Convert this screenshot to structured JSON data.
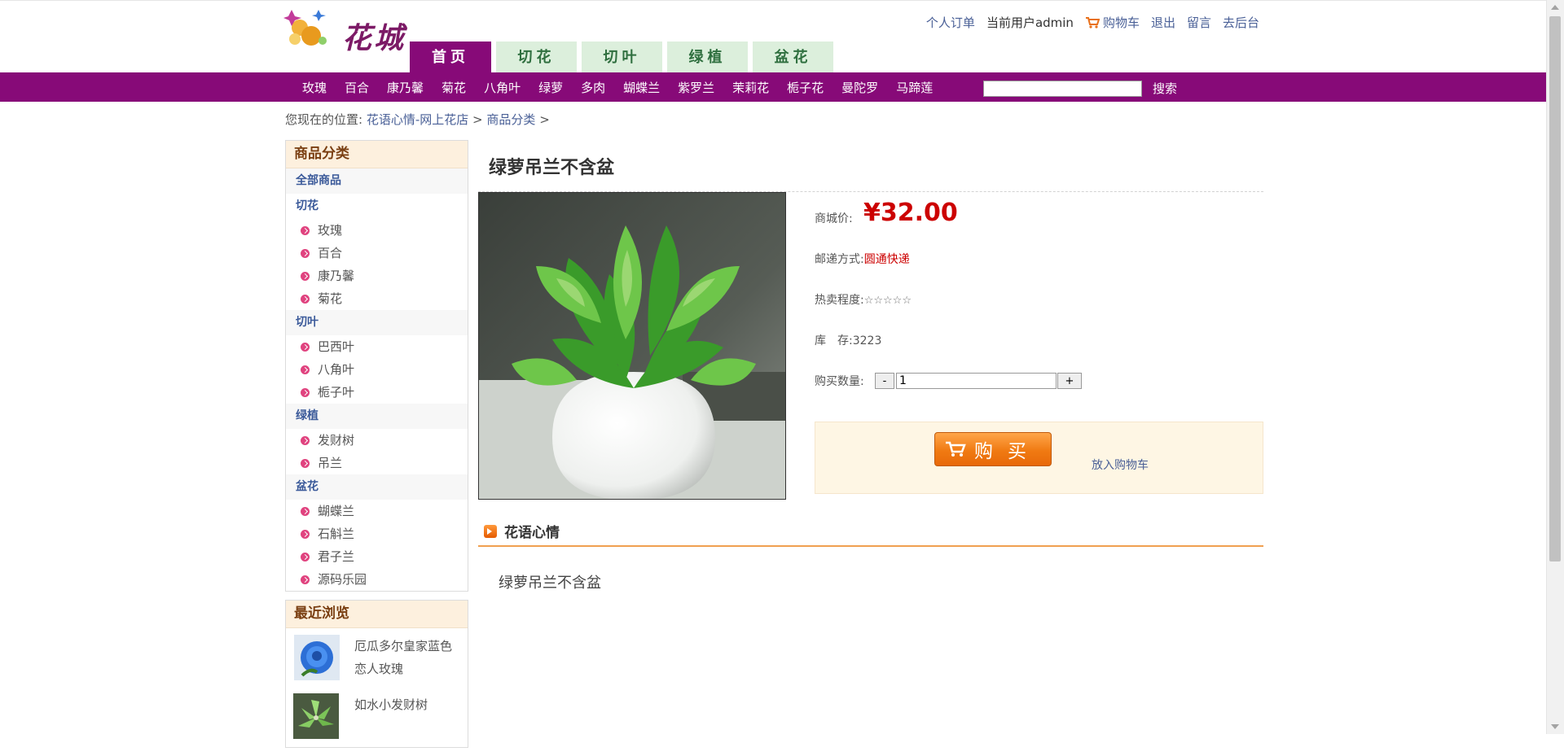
{
  "header": {
    "logo_text": "花城",
    "links": {
      "orders": "个人订单",
      "current_user": "当前用户admin",
      "cart": "购物车",
      "logout": "退出",
      "message": "留言",
      "backend": "去后台"
    },
    "tabs": [
      "首页",
      "切花",
      "切叶",
      "绿植",
      "盆花"
    ],
    "nav_items": [
      "玫瑰",
      "百合",
      "康乃馨",
      "菊花",
      "八角叶",
      "绿萝",
      "多肉",
      "蝴蝶兰",
      "紫罗兰",
      "茉莉花",
      "栀子花",
      "曼陀罗",
      "马蹄莲"
    ],
    "search_placeholder": "",
    "search_button": "搜索"
  },
  "breadcrumb": {
    "prefix": "您现在的位置:",
    "home": "花语心情-网上花店",
    "sep1": ">",
    "category": "商品分类",
    "sep2": ">"
  },
  "sidebar": {
    "category_title": "商品分类",
    "all_goods": "全部商品",
    "groups": {
      "cut_flowers": {
        "name": "切花",
        "items": [
          "玫瑰",
          "百合",
          "康乃馨",
          "菊花"
        ]
      },
      "cut_leaves": {
        "name": "切叶",
        "items": [
          "巴西叶",
          "八角叶",
          "栀子叶"
        ]
      },
      "green_plants": {
        "name": "绿植",
        "items": [
          "发财树",
          "吊兰"
        ]
      },
      "potted": {
        "name": "盆花",
        "items": [
          "蝴蝶兰",
          "石斛兰",
          "君子兰",
          "源码乐园"
        ]
      }
    },
    "recent_title": "最近浏览",
    "recent": [
      "厄瓜多尔皇家蓝色恋人玫瑰",
      "如水小发财树"
    ]
  },
  "product": {
    "title": "绿萝吊兰不含盆",
    "price_label": "商城价:",
    "price": "¥32.00",
    "shipping_label": "邮递方式:",
    "shipping_value": "圆通快递",
    "hot_label": "热卖程度:",
    "hot_stars": "☆☆☆☆☆",
    "stock_label": "库　存:",
    "stock_value": "3223",
    "qty_label": "购买数量:",
    "qty_minus": "-",
    "qty_value": "1",
    "qty_plus": "+",
    "buy_label": "购买",
    "add_cart": "放入购物车",
    "desc_title": "花语心情",
    "desc_text": "绿萝吊兰不含盆"
  },
  "colors": {
    "brand_purple": "#870a78",
    "price_red": "#cc0000",
    "tab_green_bg": "#dcefdc",
    "link_blue": "#4a6097",
    "accent_orange": "#f07a12"
  },
  "icons": [
    "logo-image",
    "cart-icon",
    "bullet-arrow-icon",
    "buy-cart-icon",
    "section-arrow-icon"
  ]
}
